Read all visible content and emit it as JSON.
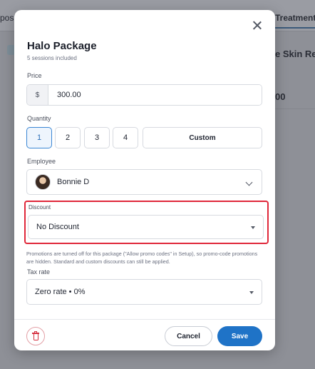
{
  "background": {
    "tab_left": "posi",
    "tab_right": "Treatments",
    "heading_right": "e Skin Reju",
    "value_right": "00"
  },
  "modal": {
    "title": "Halo Package",
    "subtitle": "5 sessions included",
    "close_icon": "close-icon"
  },
  "price": {
    "label": "Price",
    "currency_symbol": "$",
    "value": "300.00"
  },
  "quantity": {
    "label": "Quantity",
    "options": [
      "1",
      "2",
      "3",
      "4"
    ],
    "custom_label": "Custom",
    "selected": "1"
  },
  "employee": {
    "label": "Employee",
    "name": "Bonnie D"
  },
  "discount": {
    "label": "Discount",
    "value": "No Discount"
  },
  "note": "Promotions are turned off for this package (\"Allow promo codes\" in Setup), so promo-code promotions are hidden. Standard and custom discounts can still be applied.",
  "tax": {
    "label": "Tax rate",
    "value": "Zero rate • 0%"
  },
  "footer": {
    "cancel_label": "Cancel",
    "save_label": "Save"
  },
  "colors": {
    "accent": "#1f73c7",
    "highlight": "#e0283a",
    "delete": "#d6303f"
  }
}
